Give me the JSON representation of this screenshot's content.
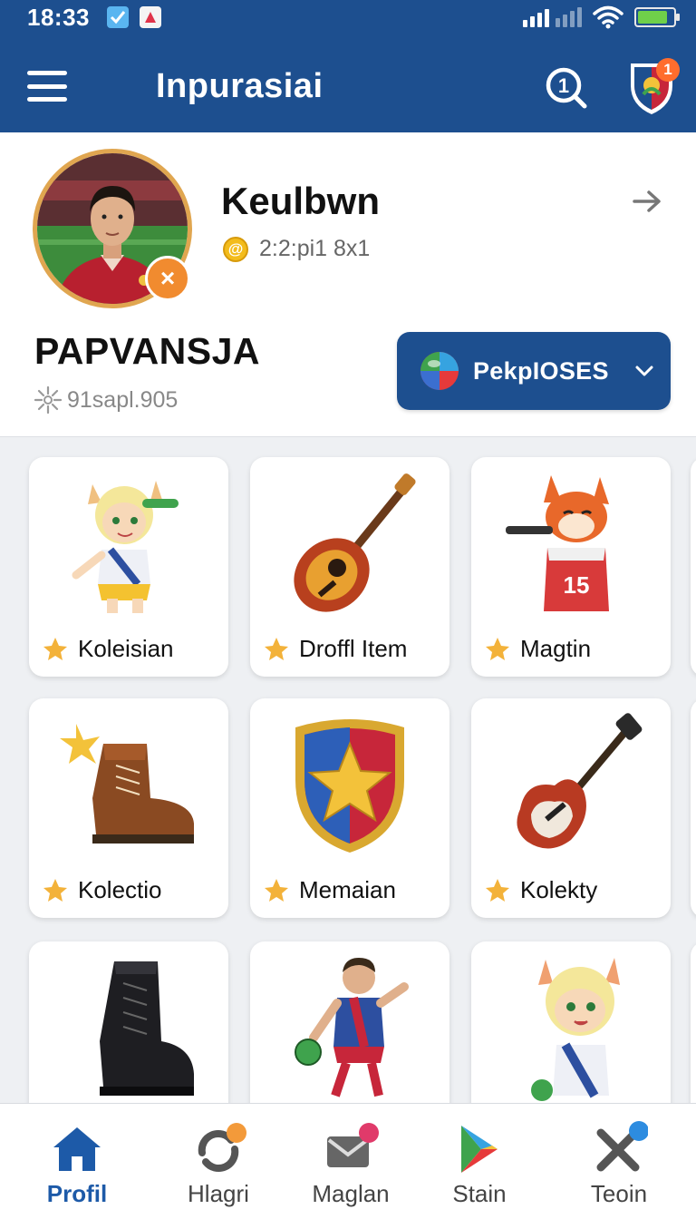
{
  "status_bar": {
    "time": "18:33",
    "battery_level": 0.85
  },
  "app_bar": {
    "title": "Inpurasiai",
    "notification_count": "1"
  },
  "profile": {
    "name": "Keulbwn",
    "meta": "2:2:pi1 8x1",
    "big_label": "PAPVANSJA",
    "sub_meta": "91sapl.905",
    "dropdown_label": "PekpIOSES"
  },
  "items": [
    {
      "label": "Koleisian",
      "icon": "fox-girl-sticker-icon"
    },
    {
      "label": "Droffl Item",
      "icon": "acoustic-guitar-icon"
    },
    {
      "label": "Magtin",
      "icon": "fox-player-icon"
    },
    {
      "label": "Kolectio",
      "icon": "brown-boot-icon"
    },
    {
      "label": "Memaian",
      "icon": "star-shield-icon"
    },
    {
      "label": "Kolekty",
      "icon": "electric-guitar-icon"
    },
    {
      "label": "",
      "icon": "black-boot-icon"
    },
    {
      "label": "",
      "icon": "soccer-player-icon"
    },
    {
      "label": "",
      "icon": "fox-girl-player-icon"
    }
  ],
  "bottom_nav": [
    {
      "label": "Profil",
      "icon": "home-icon",
      "active": true
    },
    {
      "label": "Hlagri",
      "icon": "refresh-icon",
      "active": false
    },
    {
      "label": "Maglan",
      "icon": "mail-icon",
      "active": false
    },
    {
      "label": "Stain",
      "icon": "play-store-icon",
      "active": false
    },
    {
      "label": "Teoin",
      "icon": "tools-icon",
      "active": false
    }
  ],
  "colors": {
    "brand": "#1d4f8f",
    "accent": "#f18b2f",
    "star": "#f3b23a",
    "active_nav": "#1d5aa8"
  }
}
